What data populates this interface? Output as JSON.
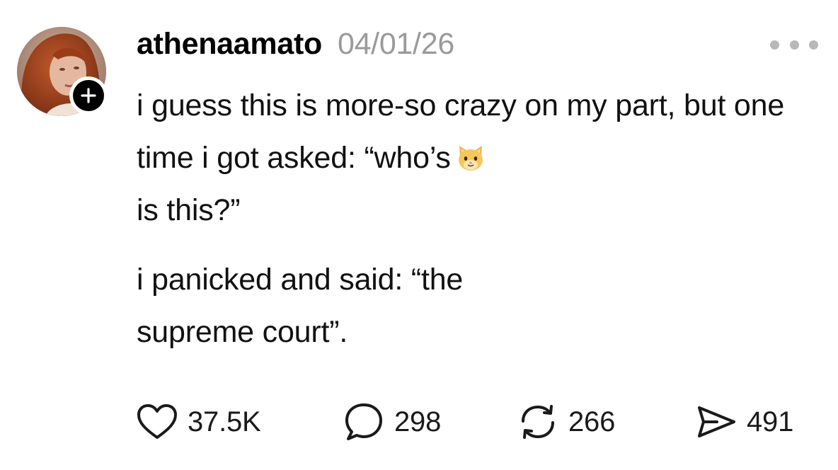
{
  "post": {
    "username": "athenaamato",
    "date": "04/01/26",
    "paragraphs": [
      "i guess this is more-so crazy on my part, but one time i got asked: “who’s",
      "is this?”"
    ],
    "emoji": "cat-face-emoji",
    "second_paragraph": "i panicked and said: “the supreme court”."
  },
  "actions": {
    "likes": "37.5K",
    "replies": "298",
    "reposts": "266",
    "shares": "491"
  },
  "colors": {
    "text": "#111111",
    "muted": "#9a9a9a",
    "dots": "#b8b8b8",
    "badge": "#000000"
  },
  "icons": {
    "like": "heart-icon",
    "reply": "speech-bubble-icon",
    "repost": "repost-arrows-icon",
    "share": "paper-plane-icon",
    "more": "ellipsis-icon",
    "follow": "plus-icon"
  }
}
